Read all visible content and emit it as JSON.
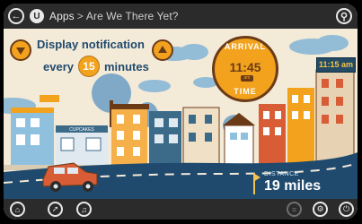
{
  "topbar": {
    "back_icon": "back-arrow-icon",
    "app_logo_letter": "U",
    "crumb_root": "Apps",
    "crumb_sep": ">",
    "crumb_current": "Are We There Yet?",
    "search_icon": "search-icon"
  },
  "notification": {
    "line1": "Display notification",
    "line2_prefix": "every",
    "interval": "15",
    "line2_suffix": "minutes",
    "decrease_icon": "triangle-down-icon",
    "increase_icon": "triangle-up-icon"
  },
  "arrival": {
    "label_top": "ARRIVAL",
    "time": "11:45",
    "ampm": "am",
    "label_bottom": "TIME"
  },
  "clock_sign": "11:15 am",
  "distance": {
    "label": "DISTANCE",
    "value": "19 miles"
  },
  "bottombar": {
    "home_icon": "home-icon",
    "navigation_icon": "navigation-icon",
    "music_icon": "headphones-icon",
    "menu_icon": "menu-icon",
    "settings_icon": "gear-icon",
    "power_icon": "power-icon"
  },
  "colors": {
    "accent": "#f2a21d",
    "dark_brown": "#6b3b18",
    "navy": "#1f4a6e",
    "bar": "#2b2b2b"
  }
}
